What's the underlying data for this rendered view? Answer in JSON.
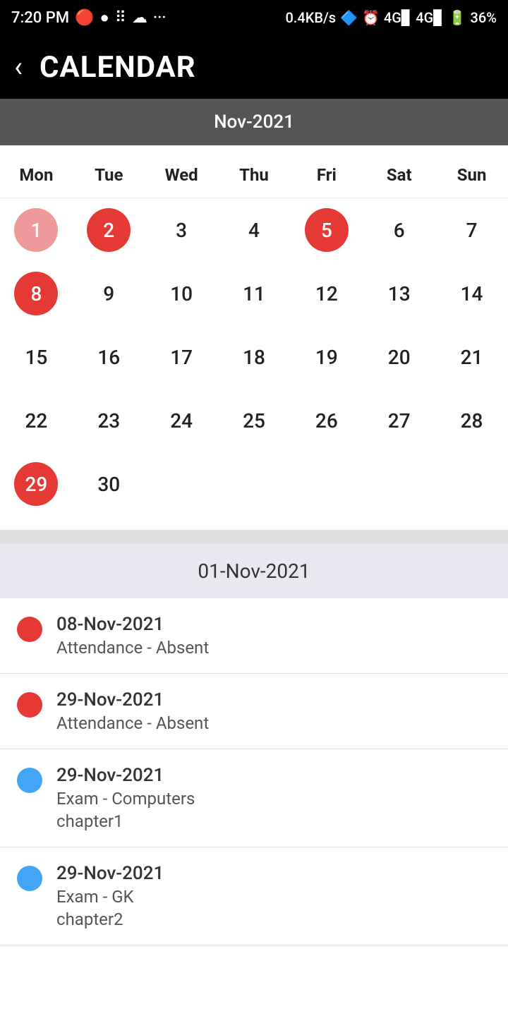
{
  "statusBar": {
    "time": "7:20 PM",
    "network": "0.4KB/s",
    "battery": "36%"
  },
  "header": {
    "backLabel": "‹",
    "title": "CALENDAR"
  },
  "calendar": {
    "monthLabel": "Nov-2021",
    "dayHeaders": [
      "Mon",
      "Tue",
      "Wed",
      "Thu",
      "Fri",
      "Sat",
      "Sun"
    ],
    "days": [
      {
        "num": "1",
        "style": "circle-red-light"
      },
      {
        "num": "2",
        "style": "circle-red"
      },
      {
        "num": "3",
        "style": "circle-none"
      },
      {
        "num": "4",
        "style": "circle-none"
      },
      {
        "num": "5",
        "style": "circle-red"
      },
      {
        "num": "6",
        "style": "circle-none"
      },
      {
        "num": "7",
        "style": "circle-none"
      },
      {
        "num": "8",
        "style": "circle-red"
      },
      {
        "num": "9",
        "style": "circle-none"
      },
      {
        "num": "10",
        "style": "circle-none"
      },
      {
        "num": "11",
        "style": "circle-none"
      },
      {
        "num": "12",
        "style": "circle-none"
      },
      {
        "num": "13",
        "style": "circle-none"
      },
      {
        "num": "14",
        "style": "circle-none"
      },
      {
        "num": "15",
        "style": "circle-none"
      },
      {
        "num": "16",
        "style": "circle-none"
      },
      {
        "num": "17",
        "style": "circle-none"
      },
      {
        "num": "18",
        "style": "circle-none"
      },
      {
        "num": "19",
        "style": "circle-none"
      },
      {
        "num": "20",
        "style": "circle-none"
      },
      {
        "num": "21",
        "style": "circle-none"
      },
      {
        "num": "22",
        "style": "circle-none"
      },
      {
        "num": "23",
        "style": "circle-none"
      },
      {
        "num": "24",
        "style": "circle-none"
      },
      {
        "num": "25",
        "style": "circle-none"
      },
      {
        "num": "26",
        "style": "circle-none"
      },
      {
        "num": "27",
        "style": "circle-none"
      },
      {
        "num": "28",
        "style": "circle-none"
      },
      {
        "num": "29",
        "style": "circle-red"
      },
      {
        "num": "30",
        "style": "circle-none"
      }
    ]
  },
  "eventsHeader": "01-Nov-2021",
  "events": [
    {
      "dotColor": "dot-red",
      "date": "08-Nov-2021",
      "title": "Attendance - Absent",
      "subtitle": ""
    },
    {
      "dotColor": "dot-red",
      "date": "29-Nov-2021",
      "title": "Attendance - Absent",
      "subtitle": ""
    },
    {
      "dotColor": "dot-blue",
      "date": "29-Nov-2021",
      "title": "Exam - Computers",
      "subtitle": "chapter1"
    },
    {
      "dotColor": "dot-blue",
      "date": "29-Nov-2021",
      "title": "Exam - GK",
      "subtitle": "chapter2"
    }
  ]
}
